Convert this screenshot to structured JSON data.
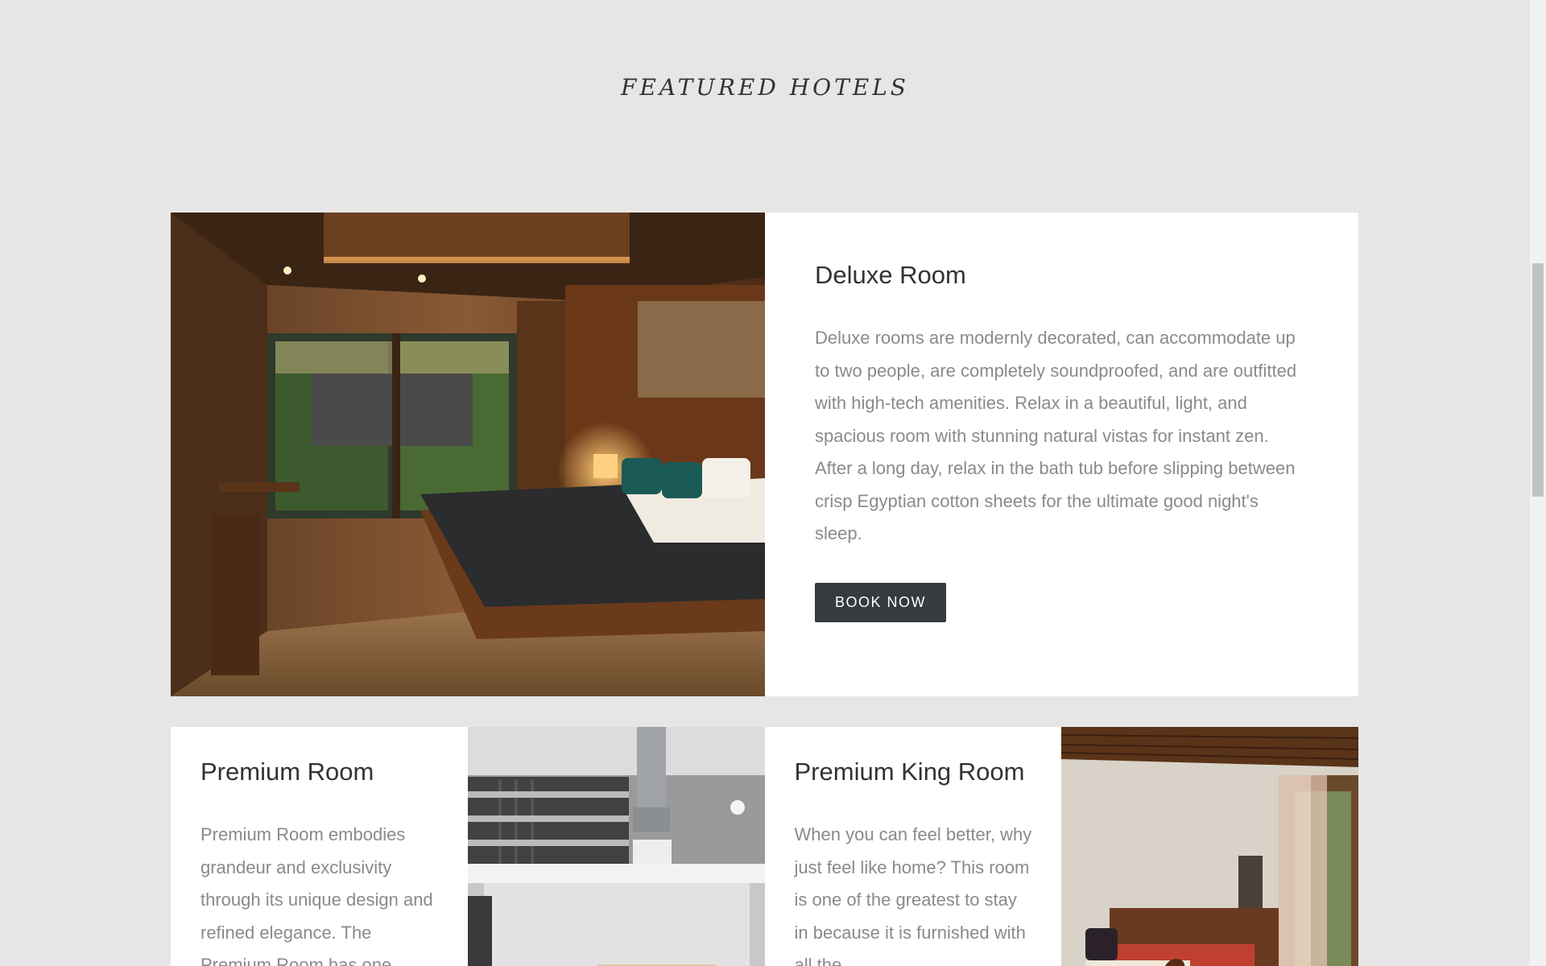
{
  "section": {
    "title": "FEATURED HOTELS"
  },
  "featured": {
    "title": "Deluxe Room",
    "description": "Deluxe rooms are modernly decorated, can accommodate up to two people, are completely soundproofed, and are outfitted with high-tech amenities. Relax in a beautiful, light, and spacious room with stunning natural vistas for instant zen. After a long day, relax in the bath tub before slipping between crisp Egyptian cotton sheets for the ultimate good night's sleep.",
    "button_label": "BOOK NOW",
    "image_name": "deluxe-room-photo"
  },
  "rooms": [
    {
      "title": "Premium Room",
      "description": "Premium Room embodies grandeur and exclusivity through its unique design and refined elegance. The Premium Room has one",
      "image_name": "premium-room-photo"
    },
    {
      "title": "Premium King Room",
      "description": "When you can feel better, why just feel like home? This room is one of the greatest to stay in because it is furnished with all the",
      "image_name": "premium-king-room-photo"
    }
  ],
  "colors": {
    "background": "#e6e6e6",
    "card": "#ffffff",
    "button": "#353b3f",
    "title_text": "#333333",
    "body_text": "#8a8a8a"
  }
}
